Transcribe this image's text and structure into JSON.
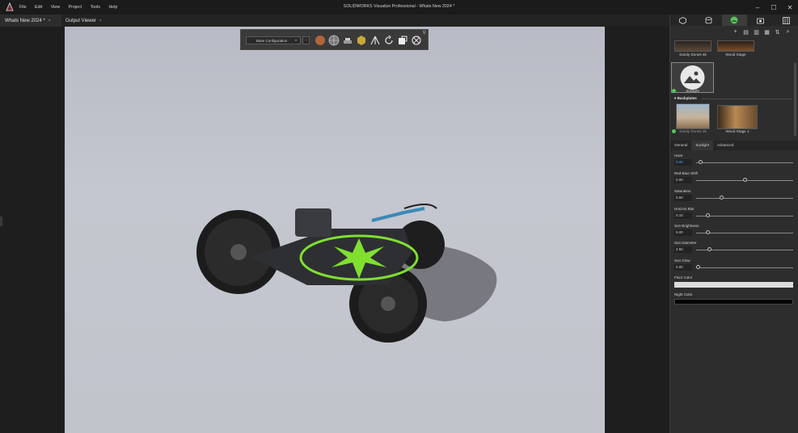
{
  "app": {
    "title": "SOLIDWORKS Visualize Professional - Whats New 2024 *",
    "menu": [
      "File",
      "Edit",
      "View",
      "Project",
      "Tools",
      "Help"
    ],
    "window_controls": [
      "–",
      "☐",
      "✕"
    ]
  },
  "tabs": [
    {
      "label": "Whats New 2024 *",
      "close": "×"
    },
    {
      "label": "Output Viewer",
      "close": "×"
    }
  ],
  "toolbar": {
    "configuration": "Base Configuration",
    "icons": [
      "appearance-sphere-icon",
      "environment-globe-icon",
      "floor-icon",
      "cube-icon",
      "tripod-icon",
      "rotate-icon",
      "display-icon",
      "camera-settings-icon"
    ]
  },
  "panel": {
    "tabs": [
      "models-icon",
      "appearances-icon",
      "scenes-icon",
      "cameras-icon",
      "libraries-icon"
    ],
    "tools": [
      "+",
      "▤",
      "▥",
      "▦",
      "⇅",
      "⌕"
    ],
    "environments": [
      {
        "label": "Sandy Dunes 4k"
      },
      {
        "label": "Wood Stage"
      },
      {
        "label": "Sunlight",
        "selected": true
      }
    ],
    "backplates_header": "Backplates",
    "backplates": [
      {
        "label": "Sandy Dunes 2k"
      },
      {
        "label": "Wood Stage 1"
      }
    ],
    "subtabs": [
      "General",
      "Sunlight",
      "Advanced"
    ],
    "active_subtab": "Sunlight",
    "properties": [
      {
        "label": "Haze",
        "value": "0.00",
        "level": 0.03
      },
      {
        "label": "Red-Blue Shift",
        "value": "0.00",
        "level": 0.5
      },
      {
        "label": "Saturation",
        "value": "0.50",
        "level": 0.25
      },
      {
        "label": "Horizon Blur",
        "value": "0.10",
        "level": 0.1
      },
      {
        "label": "Sun Brightness",
        "value": "5.00",
        "level": 0.1
      },
      {
        "label": "Sun Diameter",
        "value": "2.50",
        "level": 0.12
      },
      {
        "label": "Sun Glow",
        "value": "0.00",
        "level": 0.0
      }
    ],
    "floor_color": {
      "label": "Floor Color",
      "color": "#dcdcdc"
    },
    "night_color": {
      "label": "Night Color",
      "color": "#050505"
    }
  },
  "colors": {
    "accent_green": "#58c35a",
    "gizmo_green": "#7fe030"
  }
}
